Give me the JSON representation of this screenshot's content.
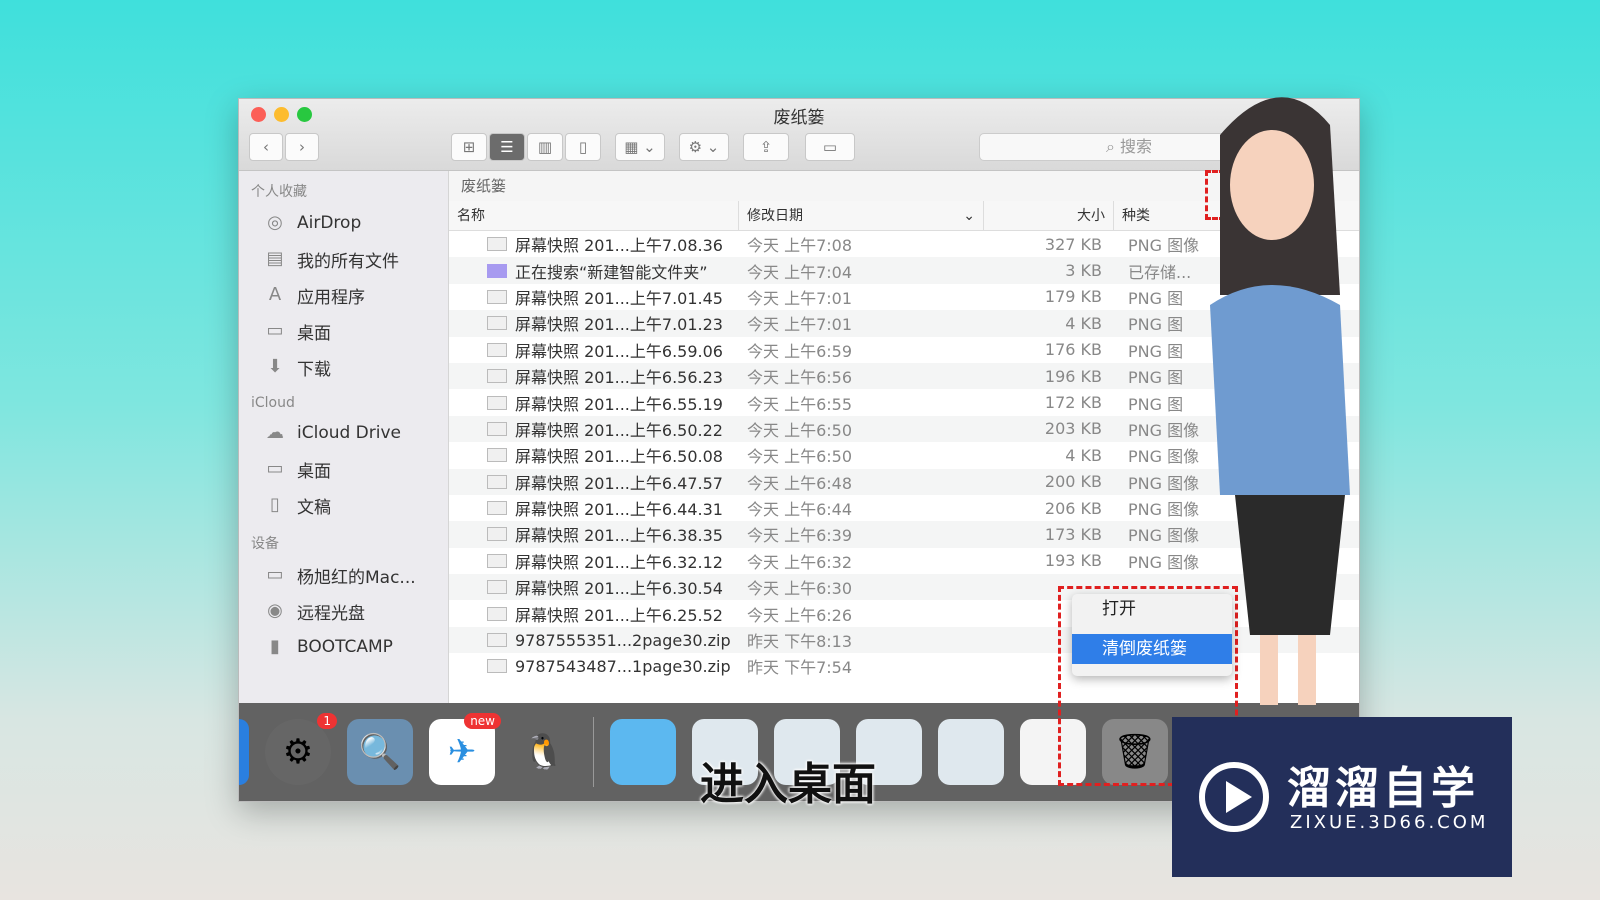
{
  "window": {
    "title": "废纸篓",
    "search_placeholder": "搜索",
    "path": "废纸篓"
  },
  "colors": {
    "accent": "#2f7ee8",
    "highlight": "#e02020",
    "logo_bg": "#232f5a"
  },
  "sidebar": {
    "favorites_title": "个人收藏",
    "favorites": [
      {
        "icon": "airdrop-icon",
        "label": "AirDrop"
      },
      {
        "icon": "all-files-icon",
        "label": "我的所有文件"
      },
      {
        "icon": "applications-icon",
        "label": "应用程序"
      },
      {
        "icon": "desktop-icon",
        "label": "桌面"
      },
      {
        "icon": "download-icon",
        "label": "下载"
      }
    ],
    "icloud_title": "iCloud",
    "icloud": [
      {
        "icon": "cloud-icon",
        "label": "iCloud Drive"
      },
      {
        "icon": "desktop-icon",
        "label": "桌面"
      },
      {
        "icon": "document-icon",
        "label": "文稿"
      }
    ],
    "devices_title": "设备",
    "devices": [
      {
        "icon": "laptop-icon",
        "label": "杨旭红的Mac..."
      },
      {
        "icon": "disc-icon",
        "label": "远程光盘"
      },
      {
        "icon": "drive-icon",
        "label": "BOOTCAMP"
      }
    ]
  },
  "columns": {
    "name": "名称",
    "date": "修改日期",
    "size": "大小",
    "kind": "种类"
  },
  "files": [
    {
      "name": "屏幕快照 201...上午7.08.36",
      "date": "今天 上午7:08",
      "size": "327 KB",
      "kind": "PNG 图像"
    },
    {
      "name": "正在搜索“新建智能文件夹”",
      "date": "今天 上午7:04",
      "size": "3 KB",
      "kind": "已存储..."
    },
    {
      "name": "屏幕快照 201...上午7.01.45",
      "date": "今天 上午7:01",
      "size": "179 KB",
      "kind": "PNG 图"
    },
    {
      "name": "屏幕快照 201...上午7.01.23",
      "date": "今天 上午7:01",
      "size": "4 KB",
      "kind": "PNG 图"
    },
    {
      "name": "屏幕快照 201...上午6.59.06",
      "date": "今天 上午6:59",
      "size": "176 KB",
      "kind": "PNG 图"
    },
    {
      "name": "屏幕快照 201...上午6.56.23",
      "date": "今天 上午6:56",
      "size": "196 KB",
      "kind": "PNG 图"
    },
    {
      "name": "屏幕快照 201...上午6.55.19",
      "date": "今天 上午6:55",
      "size": "172 KB",
      "kind": "PNG 图"
    },
    {
      "name": "屏幕快照 201...上午6.50.22",
      "date": "今天 上午6:50",
      "size": "203 KB",
      "kind": "PNG 图像"
    },
    {
      "name": "屏幕快照 201...上午6.50.08",
      "date": "今天 上午6:50",
      "size": "4 KB",
      "kind": "PNG 图像"
    },
    {
      "name": "屏幕快照 201...上午6.47.57",
      "date": "今天 上午6:48",
      "size": "200 KB",
      "kind": "PNG 图像"
    },
    {
      "name": "屏幕快照 201...上午6.44.31",
      "date": "今天 上午6:44",
      "size": "206 KB",
      "kind": "PNG 图像"
    },
    {
      "name": "屏幕快照 201...上午6.38.35",
      "date": "今天 上午6:39",
      "size": "173 KB",
      "kind": "PNG 图像"
    },
    {
      "name": "屏幕快照 201...上午6.32.12",
      "date": "今天 上午6:32",
      "size": "193 KB",
      "kind": "PNG 图像"
    },
    {
      "name": "屏幕快照 201...上午6.30.54",
      "date": "今天 上午6:30",
      "size": "",
      "kind": ""
    },
    {
      "name": "屏幕快照 201...上午6.25.52",
      "date": "今天 上午6:26",
      "size": "",
      "kind": ""
    },
    {
      "name": "9787555351...2page30.zip",
      "date": "昨天 下午8:13",
      "size": "",
      "kind": ""
    },
    {
      "name": "9787543487...1page30.zip",
      "date": "昨天 下午7:54",
      "size": "",
      "kind": ""
    }
  ],
  "context_menu": {
    "open": "打开",
    "empty_trash": "清倒废纸篓"
  },
  "dock": {
    "badge_prefs": "1",
    "badge_new": "new"
  },
  "subtitle": "进入桌面",
  "logo": {
    "name": "溜溜自学",
    "url": "ZIXUE.3D66.COM"
  }
}
